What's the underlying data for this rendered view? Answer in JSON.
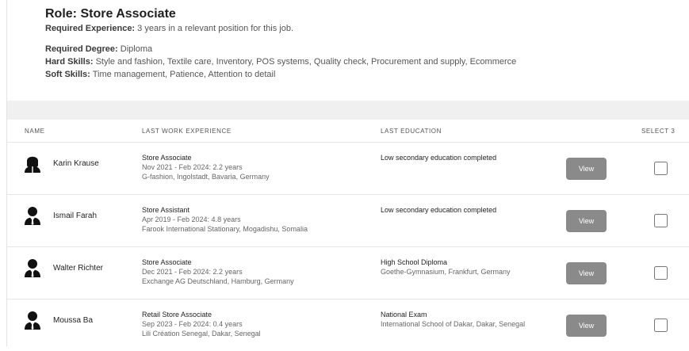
{
  "role": {
    "title": "Role: Store Associate",
    "experience_label": "Required Experience:",
    "experience_value": "3 years in a relevant position for this job.",
    "degree_label": "Required Degree:",
    "degree_value": "Diploma",
    "hard_skills_label": "Hard Skills:",
    "hard_skills_value": "Style and fashion, Textile care, Inventory, POS systems, Quality check, Procurement and supply, Ecommerce",
    "soft_skills_label": "Soft Skills:",
    "soft_skills_value": "Time management, Patience, Attention to detail"
  },
  "table": {
    "headers": {
      "name": "NAME",
      "work": "LAST WORK EXPERIENCE",
      "education": "LAST EDUCATION",
      "select": "SELECT 3"
    },
    "view_label": "View",
    "rows": [
      {
        "name": "Karin Krause",
        "avatar_icon": "female-user-icon",
        "job_title": "Store Associate",
        "job_period": "Nov 2021 - Feb 2024: 2.2 years",
        "job_place": "G-fashion, Ingolstadt, Bavaria, Germany",
        "edu_title": "Low secondary education completed",
        "edu_place": ""
      },
      {
        "name": "Ismail Farah",
        "avatar_icon": "male-user-icon",
        "job_title": "Store Assistant",
        "job_period": "Apr 2019 - Feb 2024: 4.8 years",
        "job_place": "Farook International Stationary, Mogadishu, Somalia",
        "edu_title": "Low secondary education completed",
        "edu_place": ""
      },
      {
        "name": "Walter Richter",
        "avatar_icon": "male-user-icon",
        "job_title": "Store Associate",
        "job_period": "Dec 2021 - Feb 2024: 2.2 years",
        "job_place": "Exchange AG Deutschland, Hamburg, Germany",
        "edu_title": "High School Diploma",
        "edu_place": "Goethe-Gymnasium, Frankfurt, Germany"
      },
      {
        "name": "Moussa Ba",
        "avatar_icon": "male-user-icon",
        "job_title": "Retail Store Associate",
        "job_period": "Sep 2023 - Feb 2024: 0.4 years",
        "job_place": "Lili Création Senegal, Dakar, Senegal",
        "edu_title": "National Exam",
        "edu_place": "International School of Dakar, Dakar, Senegal"
      }
    ]
  }
}
